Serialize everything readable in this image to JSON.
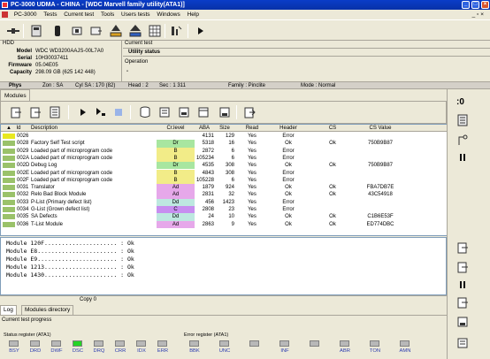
{
  "window": {
    "title": "PC-3000 UDMA - CHINA - [WDC Marvell family utility(ATA1)]"
  },
  "menu": [
    {
      "label": "PC-3000"
    },
    {
      "label": "Tests"
    },
    {
      "label": "Current test"
    },
    {
      "label": "Tools"
    },
    {
      "label": "Users tests"
    },
    {
      "label": "Windows"
    },
    {
      "label": "Help"
    }
  ],
  "hdd": {
    "header": "HDD",
    "model_label": "Model",
    "model": "WDC WD3200AAJS-00L7A0",
    "serial_label": "Serial",
    "serial": "10H30037411",
    "firmware_label": "Firmware",
    "firmware": "05.04E05",
    "capacity_label": "Capacity",
    "capacity": "298.09 GB (625 142 448)"
  },
  "current_test": {
    "header": "Current test",
    "name": "Utility status",
    "operation_label": "Operation",
    "operation": "-"
  },
  "phys": {
    "label": "Phys",
    "zone": "Zon : SA",
    "cyl": "Cyl SA : 170 (82)",
    "head": "Head : 2",
    "sec": "Sec : 1 311",
    "family": "Family : Pinclite",
    "mode": "Mode : Normal"
  },
  "modules": {
    "header": "Modules"
  },
  "table": {
    "columns": [
      "Id",
      "Description",
      "Cr.level",
      "ABA",
      "Size",
      "Read",
      "Header",
      "CS",
      "CS Value"
    ],
    "rows": [
      {
        "id": "0026",
        "desc": "",
        "level": "",
        "aba": "4131",
        "size": "129",
        "read": "Yes",
        "header": "Error",
        "cs": "",
        "csv": ""
      },
      {
        "id": "0028",
        "desc": "Factory Self Test script",
        "level": "Dr",
        "aba": "5318",
        "size": "16",
        "read": "Yes",
        "header": "Ok",
        "cs": "Ok",
        "csv": "750B9B87"
      },
      {
        "id": "0029",
        "desc": "Loaded part of microprogram code",
        "level": "B",
        "aba": "2872",
        "size": "6",
        "read": "Yes",
        "header": "Error",
        "cs": "",
        "csv": ""
      },
      {
        "id": "002A",
        "desc": "Loaded part of microprogram code",
        "level": "B",
        "aba": "105234",
        "size": "6",
        "read": "Yes",
        "header": "Error",
        "cs": "",
        "csv": ""
      },
      {
        "id": "002D",
        "desc": "Debug Log",
        "level": "Dr",
        "aba": "4535",
        "size": "308",
        "read": "Yes",
        "header": "Ok",
        "cs": "Ok",
        "csv": "750B9B87"
      },
      {
        "id": "002E",
        "desc": "Loaded part of microprogram code",
        "level": "B",
        "aba": "4843",
        "size": "308",
        "read": "Yes",
        "header": "Error",
        "cs": "",
        "csv": ""
      },
      {
        "id": "002F",
        "desc": "Loaded part of microprogram code",
        "level": "B",
        "aba": "105228",
        "size": "6",
        "read": "Yes",
        "header": "Error",
        "cs": "",
        "csv": ""
      },
      {
        "id": "0031",
        "desc": "Translator",
        "level": "Ad",
        "aba": "1879",
        "size": "924",
        "read": "Yes",
        "header": "Ok",
        "cs": "Ok",
        "csv": "FBA7DB7E"
      },
      {
        "id": "0032",
        "desc": "Relo Bad Block Module",
        "level": "Ad",
        "aba": "2831",
        "size": "32",
        "read": "Yes",
        "header": "Ok",
        "cs": "Ok",
        "csv": "43C54918"
      },
      {
        "id": "0033",
        "desc": "P-List (Primary defect list)",
        "level": "Dd",
        "aba": "456",
        "size": "1423",
        "read": "Yes",
        "header": "Error",
        "cs": "",
        "csv": ""
      },
      {
        "id": "0034",
        "desc": "G-List (Grown defect list)",
        "level": "C",
        "aba": "2808",
        "size": "23",
        "read": "Yes",
        "header": "Error",
        "cs": "",
        "csv": ""
      },
      {
        "id": "0035",
        "desc": "SA Defects",
        "level": "Dd",
        "aba": "24",
        "size": "10",
        "read": "Yes",
        "header": "Ok",
        "cs": "Ok",
        "csv": "C1B6E53F"
      },
      {
        "id": "0036",
        "desc": "T-List Module",
        "level": "Ad",
        "aba": "2863",
        "size": "9",
        "read": "Yes",
        "header": "Ok",
        "cs": "Ok",
        "csv": "ED774DBC"
      }
    ]
  },
  "level_colors": {
    "Dr": "#a8e6a0",
    "B": "#f2ec88",
    "Ad": "#e6a8ea",
    "Dd": "#bde8e0",
    "C": "#c78ef0"
  },
  "id_colors": {
    "selected": "#e8e820",
    "normal": "#9ac26a"
  },
  "log": {
    "lines": [
      "Module 120F..................... : Ok",
      "Module E8....................... : Ok",
      "Module E9....................... : Ok",
      "Module 1213..................... : Ok",
      "Module 1430..................... : Ok"
    ]
  },
  "copy_bar": {
    "text": "Copy 0"
  },
  "tabs": [
    {
      "label": "Log"
    },
    {
      "label": "Modules directory"
    }
  ],
  "progress": {
    "label": "Current test progress"
  },
  "status_register": {
    "label": "Status register (ATA1)",
    "leds": [
      "BSY",
      "DRD",
      "DWF",
      "DSC",
      "DRQ",
      "CRR",
      "IDX",
      "ERR"
    ],
    "active": "DSC",
    "active_color": "#25d425"
  },
  "error_register": {
    "label": "Error register (ATA1)",
    "leds": [
      "BBK",
      "UNC",
      "",
      "INF",
      "",
      "ABR",
      "TON",
      "AMN"
    ]
  }
}
